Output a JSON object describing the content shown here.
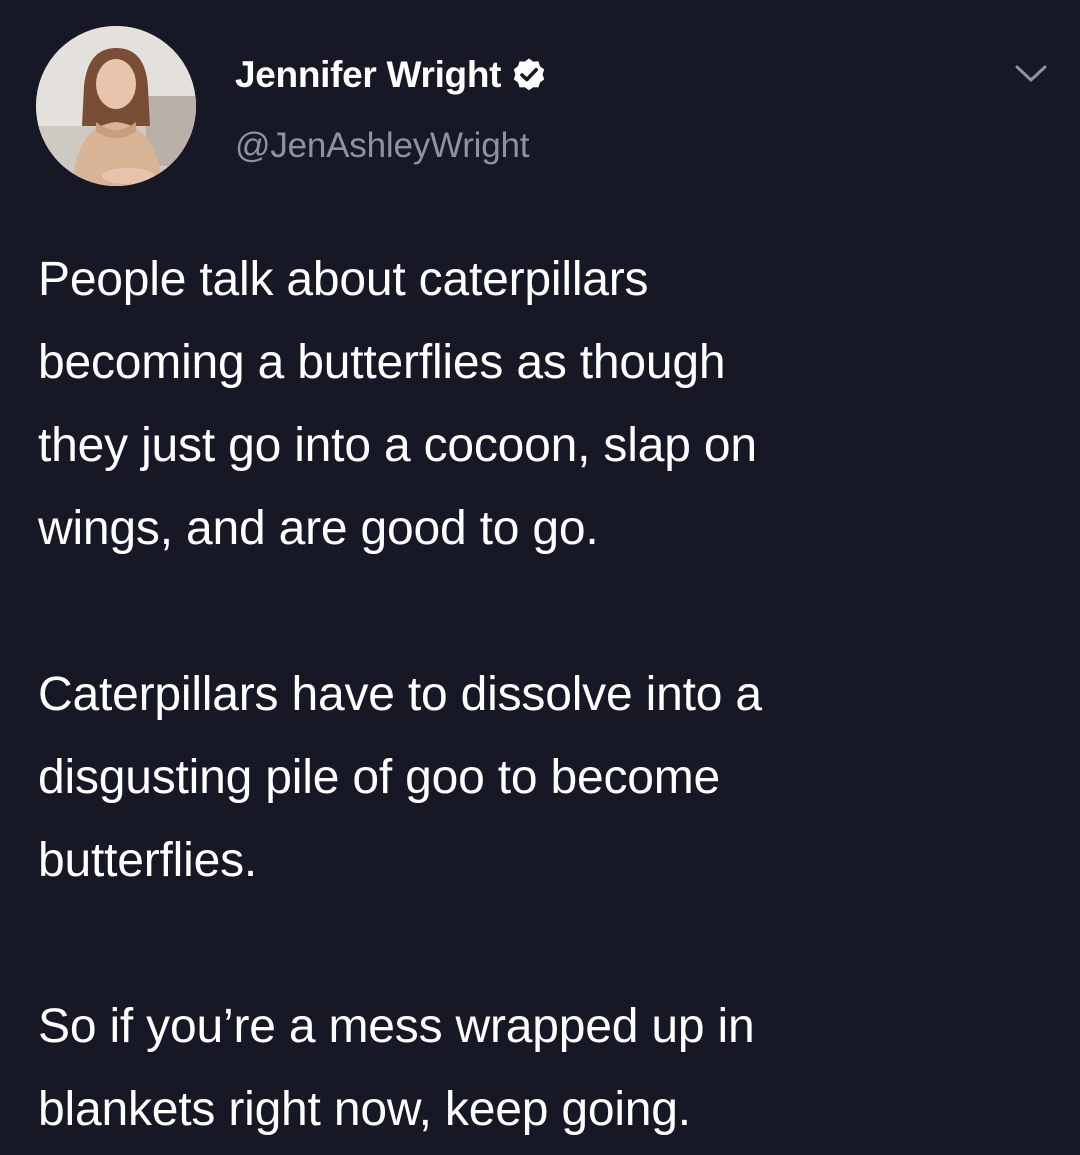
{
  "tweet": {
    "author": {
      "display_name": "Jennifer Wright",
      "handle": "@JenAshleyWright",
      "verified": true,
      "avatar_icon": "profile-photo",
      "verified_icon": "verified-badge-icon"
    },
    "menu_icon": "chevron-down-icon",
    "paragraphs": [
      "People talk about caterpillars\nbecoming a butterflies as though\nthey just go into a cocoon, slap on\nwings, and are good to go.",
      "Caterpillars have to dissolve into a\ndisgusting pile of goo to become\nbutterflies.",
      "So if you’re a mess wrapped up in\nblankets right now, keep going."
    ]
  },
  "colors": {
    "background": "#161825",
    "text": "#ffffff",
    "secondary_text": "#8b92a1",
    "badge": "#ffffff"
  }
}
